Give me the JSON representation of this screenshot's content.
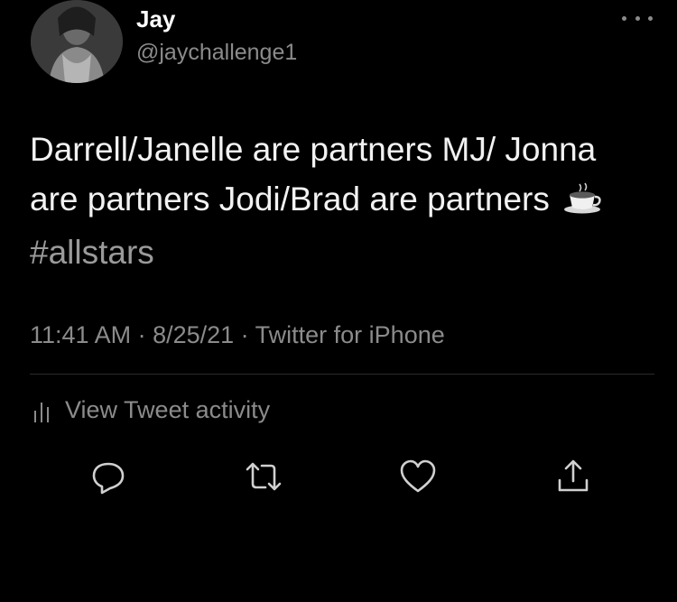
{
  "tweet": {
    "author": {
      "display_name": "Jay",
      "handle": "@jaychallenge1"
    },
    "text_before_emoji": "Darrell/Janelle are partners MJ/ Jonna are partners Jodi/Brad are partners",
    "emoji": "coffee-icon",
    "hashtag": "#allstars",
    "meta": "11:41 AM · 8/25/21 · Twitter for iPhone",
    "activity_label": "View Tweet activity"
  },
  "actions": [
    "reply-icon",
    "retweet-icon",
    "like-icon",
    "share-icon"
  ],
  "colors": {
    "background": "#000000",
    "primary_text": "#f2f2f2",
    "secondary_text": "#8b8b8b"
  }
}
